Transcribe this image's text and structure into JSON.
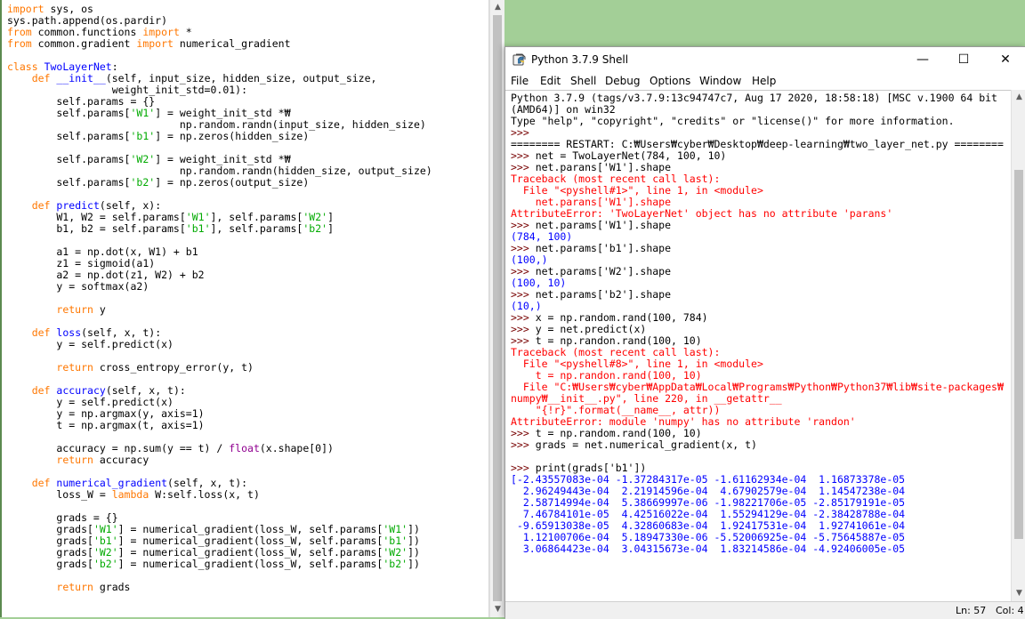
{
  "editor": {
    "lines": [
      [
        [
          "kw",
          "import"
        ],
        [
          "t",
          " sys, os"
        ]
      ],
      [
        [
          "t",
          "sys.path.append(os.pardir)"
        ]
      ],
      [
        [
          "kw",
          "from"
        ],
        [
          "t",
          " common.functions "
        ],
        [
          "kw",
          "import"
        ],
        [
          "t",
          " *"
        ]
      ],
      [
        [
          "kw",
          "from"
        ],
        [
          "t",
          " common.gradient "
        ],
        [
          "kw",
          "import"
        ],
        [
          "t",
          " numerical_gradient"
        ]
      ],
      [
        [
          "t",
          ""
        ]
      ],
      [
        [
          "kw",
          "class"
        ],
        [
          "t",
          " "
        ],
        [
          "fn",
          "TwoLayerNet"
        ],
        [
          "t",
          ":"
        ]
      ],
      [
        [
          "t",
          "    "
        ],
        [
          "kw",
          "def"
        ],
        [
          "t",
          " "
        ],
        [
          "fn",
          "__init__"
        ],
        [
          "t",
          "(self, input_size, hidden_size, output_size,"
        ]
      ],
      [
        [
          "t",
          "                 weight_init_std=0.01):"
        ]
      ],
      [
        [
          "t",
          "        self.params = {}"
        ]
      ],
      [
        [
          "t",
          "        self.params["
        ],
        [
          "st",
          "'W1'"
        ],
        [
          "t",
          "] = weight_init_std *₩"
        ]
      ],
      [
        [
          "t",
          "                            np.random.randn(input_size, hidden_size)"
        ]
      ],
      [
        [
          "t",
          "        self.params["
        ],
        [
          "st",
          "'b1'"
        ],
        [
          "t",
          "] = np.zeros(hidden_size)"
        ]
      ],
      [
        [
          "t",
          ""
        ]
      ],
      [
        [
          "t",
          "        self.params["
        ],
        [
          "st",
          "'W2'"
        ],
        [
          "t",
          "] = weight_init_std *₩"
        ]
      ],
      [
        [
          "t",
          "                            np.random.randn(hidden_size, output_size)"
        ]
      ],
      [
        [
          "t",
          "        self.params["
        ],
        [
          "st",
          "'b2'"
        ],
        [
          "t",
          "] = np.zeros(output_size)"
        ]
      ],
      [
        [
          "t",
          ""
        ]
      ],
      [
        [
          "t",
          "    "
        ],
        [
          "kw",
          "def"
        ],
        [
          "t",
          " "
        ],
        [
          "fn",
          "predict"
        ],
        [
          "t",
          "(self, x):"
        ]
      ],
      [
        [
          "t",
          "        W1, W2 = self.params["
        ],
        [
          "st",
          "'W1'"
        ],
        [
          "t",
          "], self.params["
        ],
        [
          "st",
          "'W2'"
        ],
        [
          "t",
          "]"
        ]
      ],
      [
        [
          "t",
          "        b1, b2 = self.params["
        ],
        [
          "st",
          "'b1'"
        ],
        [
          "t",
          "], self.params["
        ],
        [
          "st",
          "'b2'"
        ],
        [
          "t",
          "]"
        ]
      ],
      [
        [
          "t",
          ""
        ]
      ],
      [
        [
          "t",
          "        a1 = np.dot(x, W1) + b1"
        ]
      ],
      [
        [
          "t",
          "        z1 = sigmoid(a1)"
        ]
      ],
      [
        [
          "t",
          "        a2 = np.dot(z1, W2) + b2"
        ]
      ],
      [
        [
          "t",
          "        y = softmax(a2)"
        ]
      ],
      [
        [
          "t",
          ""
        ]
      ],
      [
        [
          "t",
          "        "
        ],
        [
          "kw",
          "return"
        ],
        [
          "t",
          " y"
        ]
      ],
      [
        [
          "t",
          ""
        ]
      ],
      [
        [
          "t",
          "    "
        ],
        [
          "kw",
          "def"
        ],
        [
          "t",
          " "
        ],
        [
          "fn",
          "loss"
        ],
        [
          "t",
          "(self, x, t):"
        ]
      ],
      [
        [
          "t",
          "        y = self.predict(x)"
        ]
      ],
      [
        [
          "t",
          ""
        ]
      ],
      [
        [
          "t",
          "        "
        ],
        [
          "kw",
          "return"
        ],
        [
          "t",
          " cross_entropy_error(y, t)"
        ]
      ],
      [
        [
          "t",
          ""
        ]
      ],
      [
        [
          "t",
          "    "
        ],
        [
          "kw",
          "def"
        ],
        [
          "t",
          " "
        ],
        [
          "fn",
          "accuracy"
        ],
        [
          "t",
          "(self, x, t):"
        ]
      ],
      [
        [
          "t",
          "        y = self.predict(x)"
        ]
      ],
      [
        [
          "t",
          "        y = np.argmax(y, axis=1)"
        ]
      ],
      [
        [
          "t",
          "        t = np.argmax(t, axis=1)"
        ]
      ],
      [
        [
          "t",
          ""
        ]
      ],
      [
        [
          "t",
          "        accuracy = np.sum(y == t) / "
        ],
        [
          "bi",
          "float"
        ],
        [
          "t",
          "(x.shape[0])"
        ]
      ],
      [
        [
          "t",
          "        "
        ],
        [
          "kw",
          "return"
        ],
        [
          "t",
          " accuracy"
        ]
      ],
      [
        [
          "t",
          ""
        ]
      ],
      [
        [
          "t",
          "    "
        ],
        [
          "kw",
          "def"
        ],
        [
          "t",
          " "
        ],
        [
          "fn",
          "numerical_gradient"
        ],
        [
          "t",
          "(self, x, t):"
        ]
      ],
      [
        [
          "t",
          "        loss_W = "
        ],
        [
          "kw",
          "lambda"
        ],
        [
          "t",
          " W:self.loss(x, t)"
        ]
      ],
      [
        [
          "t",
          ""
        ]
      ],
      [
        [
          "t",
          "        grads = {}"
        ]
      ],
      [
        [
          "t",
          "        grads["
        ],
        [
          "st",
          "'W1'"
        ],
        [
          "t",
          "] = numerical_gradient(loss_W, self.params["
        ],
        [
          "st",
          "'W1'"
        ],
        [
          "t",
          "])"
        ]
      ],
      [
        [
          "t",
          "        grads["
        ],
        [
          "st",
          "'b1'"
        ],
        [
          "t",
          "] = numerical_gradient(loss_W, self.params["
        ],
        [
          "st",
          "'b1'"
        ],
        [
          "t",
          "])"
        ]
      ],
      [
        [
          "t",
          "        grads["
        ],
        [
          "st",
          "'W2'"
        ],
        [
          "t",
          "] = numerical_gradient(loss_W, self.params["
        ],
        [
          "st",
          "'W2'"
        ],
        [
          "t",
          "])"
        ]
      ],
      [
        [
          "t",
          "        grads["
        ],
        [
          "st",
          "'b2'"
        ],
        [
          "t",
          "] = numerical_gradient(loss_W, self.params["
        ],
        [
          "st",
          "'b2'"
        ],
        [
          "t",
          "])"
        ]
      ],
      [
        [
          "t",
          ""
        ]
      ],
      [
        [
          "t",
          "        "
        ],
        [
          "kw",
          "return"
        ],
        [
          "t",
          " grads"
        ]
      ]
    ]
  },
  "shell": {
    "title": "Python 3.7.9 Shell",
    "icon": "python-icon",
    "window_buttons": {
      "minimize": "—",
      "maximize": "☐",
      "close": "✕"
    },
    "menu": [
      "File",
      "Edit",
      "Shell",
      "Debug",
      "Options",
      "Window",
      "Help"
    ],
    "lines": [
      [
        [
          "cmd",
          "Python 3.7.9 (tags/v3.7.9:13c94747c7, Aug 17 2020, 18:58:18) [MSC v.1900 64 bit"
        ]
      ],
      [
        [
          "cmd",
          "(AMD64)] on win32"
        ]
      ],
      [
        [
          "cmd",
          "Type \"help\", \"copyright\", \"credits\" or \"license()\" for more information."
        ]
      ],
      [
        [
          "prompt",
          ">>> "
        ]
      ],
      [
        [
          "cmd",
          "======== RESTART: C:₩Users₩cyber₩Desktop₩deep-learning₩two_layer_net.py ========"
        ]
      ],
      [
        [
          "prompt",
          ">>> "
        ],
        [
          "cmd",
          "net = TwoLayerNet(784, 100, 10)"
        ]
      ],
      [
        [
          "prompt",
          ">>> "
        ],
        [
          "cmd",
          "net.parans['W1'].shape"
        ]
      ],
      [
        [
          "err",
          "Traceback (most recent call last):"
        ]
      ],
      [
        [
          "err",
          "  File \"<pyshell#1>\", line 1, in <module>"
        ]
      ],
      [
        [
          "err",
          "    net.parans['W1'].shape"
        ]
      ],
      [
        [
          "err",
          "AttributeError: 'TwoLayerNet' object has no attribute 'parans'"
        ]
      ],
      [
        [
          "prompt",
          ">>> "
        ],
        [
          "cmd",
          "net.params['W1'].shape"
        ]
      ],
      [
        [
          "out",
          "(784, 100)"
        ]
      ],
      [
        [
          "prompt",
          ">>> "
        ],
        [
          "cmd",
          "net.params['b1'].shape"
        ]
      ],
      [
        [
          "out",
          "(100,)"
        ]
      ],
      [
        [
          "prompt",
          ">>> "
        ],
        [
          "cmd",
          "net.params['W2'].shape"
        ]
      ],
      [
        [
          "out",
          "(100, 10)"
        ]
      ],
      [
        [
          "prompt",
          ">>> "
        ],
        [
          "cmd",
          "net.params['b2'].shape"
        ]
      ],
      [
        [
          "out",
          "(10,)"
        ]
      ],
      [
        [
          "prompt",
          ">>> "
        ],
        [
          "cmd",
          "x = np.random.rand(100, 784)"
        ]
      ],
      [
        [
          "prompt",
          ">>> "
        ],
        [
          "cmd",
          "y = net.predict(x)"
        ]
      ],
      [
        [
          "prompt",
          ">>> "
        ],
        [
          "cmd",
          "t = np.randon.rand(100, 10)"
        ]
      ],
      [
        [
          "err",
          "Traceback (most recent call last):"
        ]
      ],
      [
        [
          "err",
          "  File \"<pyshell#8>\", line 1, in <module>"
        ]
      ],
      [
        [
          "err",
          "    t = np.randon.rand(100, 10)"
        ]
      ],
      [
        [
          "err",
          "  File \"C:₩Users₩cyber₩AppData₩Local₩Programs₩Python₩Python37₩lib₩site-packages₩"
        ]
      ],
      [
        [
          "err",
          "numpy₩__init__.py\", line 220, in __getattr__"
        ]
      ],
      [
        [
          "err",
          "    \"{!r}\".format(__name__, attr))"
        ]
      ],
      [
        [
          "err",
          "AttributeError: module 'numpy' has no attribute 'randon'"
        ]
      ],
      [
        [
          "prompt",
          ">>> "
        ],
        [
          "cmd",
          "t = np.random.rand(100, 10)"
        ]
      ],
      [
        [
          "prompt",
          ">>> "
        ],
        [
          "cmd",
          "grads = net.numerical_gradient(x, t)"
        ]
      ],
      [
        [
          "cmd",
          ""
        ]
      ],
      [
        [
          "prompt",
          ">>> "
        ],
        [
          "cmd",
          "print(grads['b1'])"
        ]
      ],
      [
        [
          "out",
          "[-2.43557083e-04 -1.37284317e-05 -1.61162934e-04  1.16873378e-05"
        ]
      ],
      [
        [
          "out",
          "  2.96249443e-04  2.21914596e-04  4.67902579e-04  1.14547238e-04"
        ]
      ],
      [
        [
          "out",
          "  2.58714994e-04  5.38669997e-06 -1.98221706e-05 -2.85179191e-05"
        ]
      ],
      [
        [
          "out",
          "  7.46784101e-05  4.42516022e-04  1.55294129e-04 -2.38428788e-04"
        ]
      ],
      [
        [
          "out",
          " -9.65913038e-05  4.32860683e-04  1.92417531e-04  1.92741061e-04"
        ]
      ],
      [
        [
          "out",
          "  1.12100706e-04  5.18947330e-06 -5.52006925e-04 -5.75645887e-05"
        ]
      ],
      [
        [
          "out",
          "  3.06864423e-04  3.04315673e-04  1.83214586e-04 -4.92406005e-05"
        ]
      ]
    ],
    "status": {
      "line": "Ln: 57",
      "col": "Col: 4"
    }
  }
}
